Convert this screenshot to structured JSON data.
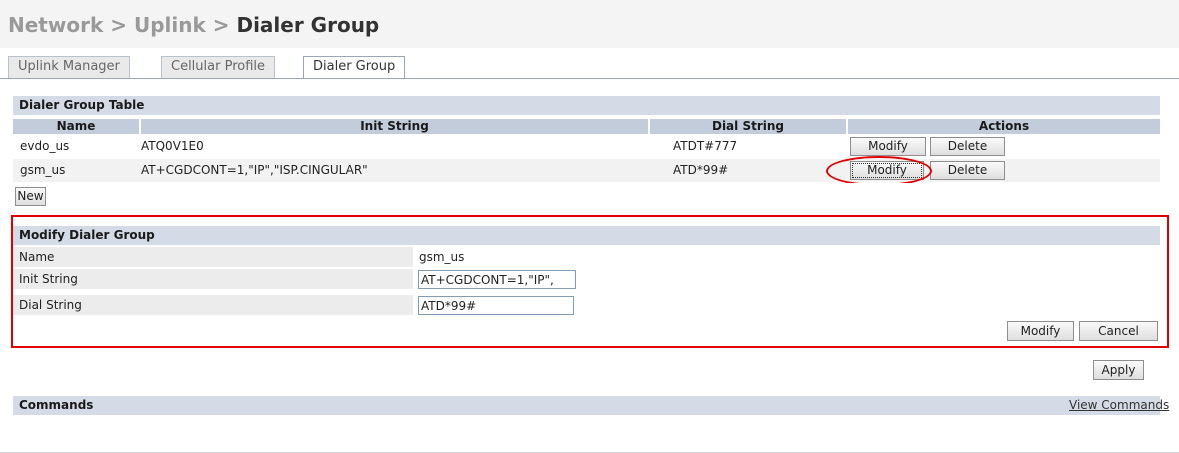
{
  "breadcrumb": {
    "part1": "Network",
    "sep1": ">",
    "part2": "Uplink",
    "sep2": ">",
    "current": "Dialer Group"
  },
  "tabs": [
    {
      "label": "Uplink Manager",
      "active": false
    },
    {
      "label": "Cellular Profile",
      "active": false
    },
    {
      "label": "Dialer Group",
      "active": true
    }
  ],
  "dialer_table": {
    "title": "Dialer Group Table",
    "headers": [
      "Name",
      "Init String",
      "Dial String",
      "Actions"
    ],
    "rows": [
      {
        "name": "evdo_us",
        "init": "ATQ0V1E0",
        "dial": "ATDT#777",
        "modify": "Modify",
        "delete": "Delete"
      },
      {
        "name": "gsm_us",
        "init": "AT+CGDCONT=1,\"IP\",\"ISP.CINGULAR\"",
        "dial": "ATD*99#",
        "modify": "Modify",
        "delete": "Delete"
      }
    ],
    "new_label": "New"
  },
  "modify_form": {
    "title": "Modify Dialer Group",
    "name_label": "Name",
    "name_value": "gsm_us",
    "init_label": "Init String",
    "init_value": "AT+CGDCONT=1,\"IP\",",
    "dial_label": "Dial String",
    "dial_value": "ATD*99#",
    "modify_label": "Modify",
    "cancel_label": "Cancel"
  },
  "apply_label": "Apply",
  "commands": {
    "title": "Commands",
    "link": "View Commands"
  },
  "colors": {
    "section_header": "#d4dbe6",
    "column_header": "#c2ccdb",
    "highlight": "#e00000"
  }
}
